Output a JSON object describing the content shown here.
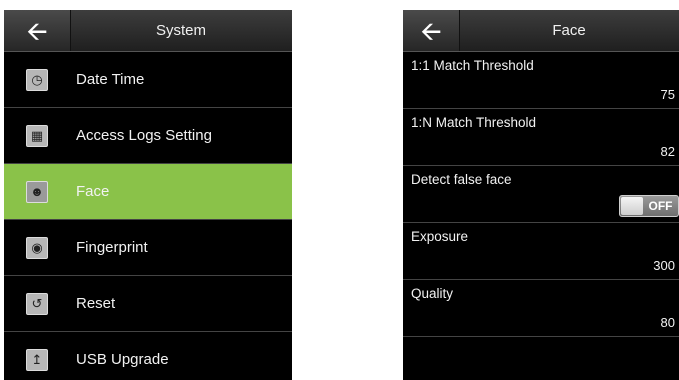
{
  "left_screen": {
    "back_icon": "back-arrow-icon",
    "title": "System",
    "items": [
      {
        "label": "Date Time",
        "icon": "clock-icon"
      },
      {
        "label": "Access Logs Setting",
        "icon": "access-logs-icon"
      },
      {
        "label": "Face",
        "icon": "face-icon",
        "selected": true
      },
      {
        "label": "Fingerprint",
        "icon": "fingerprint-icon"
      },
      {
        "label": "Reset",
        "icon": "reset-icon"
      },
      {
        "label": "USB Upgrade",
        "icon": "usb-upgrade-icon"
      }
    ],
    "selected_color": "#8ac249"
  },
  "right_screen": {
    "back_icon": "back-arrow-icon",
    "title": "Face",
    "settings": [
      {
        "label": "1:1 Match Threshold",
        "value": "75"
      },
      {
        "label": "1:N Match Threshold",
        "value": "82"
      },
      {
        "label": "Detect false face",
        "toggle": "OFF"
      },
      {
        "label": "Exposure",
        "value": "300"
      },
      {
        "label": "Quality",
        "value": "80"
      }
    ]
  }
}
